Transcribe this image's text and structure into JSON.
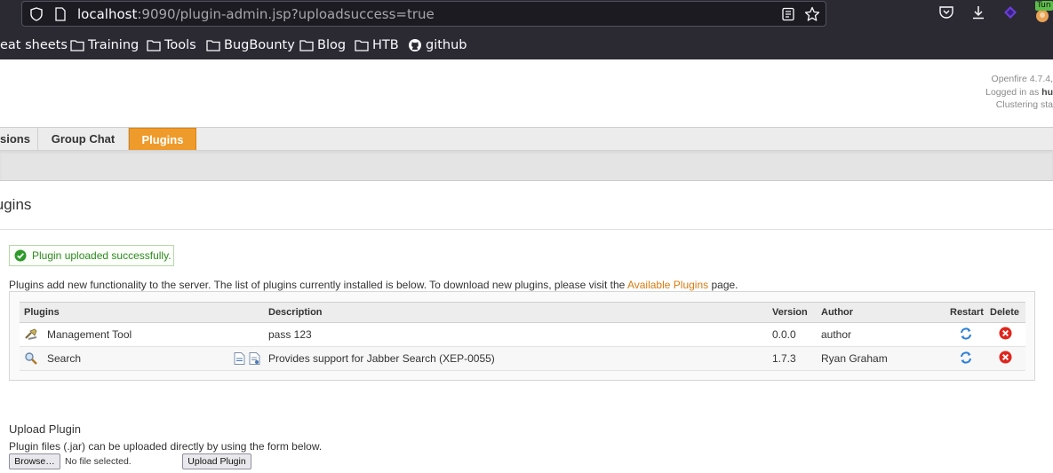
{
  "browser": {
    "url_host": "localhost",
    "url_rest": ":9090/plugin-admin.jsp?uploadsuccess=true",
    "extension_badge": "Tun",
    "bookmarks": [
      {
        "label": "eat sheets",
        "icon": "none"
      },
      {
        "label": "Training",
        "icon": "folder-icon"
      },
      {
        "label": "Tools",
        "icon": "folder-icon"
      },
      {
        "label": "BugBounty",
        "icon": "folder-icon"
      },
      {
        "label": "Blog",
        "icon": "folder-icon"
      },
      {
        "label": "HTB",
        "icon": "folder-icon"
      },
      {
        "label": "github",
        "icon": "github-icon"
      }
    ]
  },
  "header": {
    "version": "Openfire 4.7.4,",
    "logged_in_prefix": "Logged in as",
    "logged_in_user": "hu",
    "clustering": "Clustering sta"
  },
  "tabs": [
    {
      "label": "sions",
      "active": false
    },
    {
      "label": "Group Chat",
      "active": false
    },
    {
      "label": "Plugins",
      "active": true
    }
  ],
  "page_title": "lugins",
  "success_message": "Plugin uploaded successfully.",
  "intro": {
    "text": "Plugins add new functionality to the server. The list of plugins currently installed is below. To download new plugins, please visit the",
    "link": "Available Plugins",
    "suffix": "page."
  },
  "table": {
    "headers": [
      "Plugins",
      "Description",
      "Version",
      "Author",
      "Restart",
      "Delete"
    ],
    "rows": [
      {
        "name": "Management Tool",
        "icon": "tools-icon",
        "description": "pass 123",
        "version": "0.0.0",
        "author": "author"
      },
      {
        "name": "Search",
        "icon": "search-icon",
        "description": "Provides support for Jabber Search (XEP-0055)",
        "version": "1.7.3",
        "author": "Ryan Graham"
      }
    ]
  },
  "upload": {
    "title": "Upload Plugin",
    "description": "Plugin files (.jar) can be uploaded directly by using the form below.",
    "browse_label": "Browse…",
    "no_file": "No file selected.",
    "upload_label": "Upload Plugin"
  },
  "colors": {
    "accent_tab": "#ef9b2b",
    "link": "#d77a10",
    "success_text": "#2d8a1f",
    "browser_bg": "#2b2a33"
  }
}
